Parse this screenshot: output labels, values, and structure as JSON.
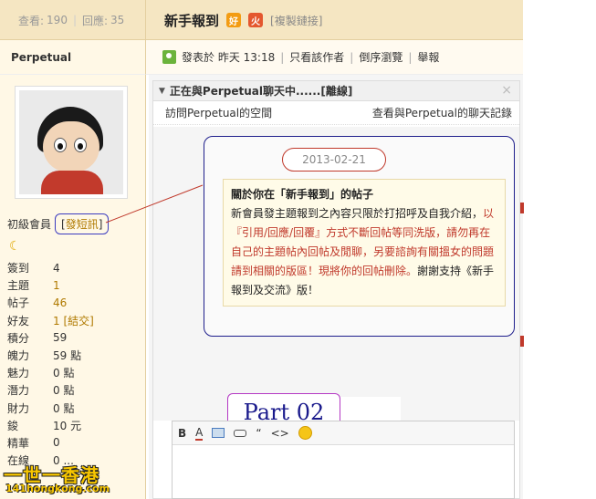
{
  "header": {
    "views_label": "查看:",
    "views": "190",
    "replies_label": "回應:",
    "replies": "35",
    "post_title": "新手報到",
    "badge_hao": "好",
    "badge_huo": "火",
    "copy_link": "[複製鏈接]"
  },
  "user": {
    "name": "Perpetual",
    "rank": "初級會員",
    "pm_label": "發短訊",
    "stats": [
      {
        "k": "簽到",
        "v": "4"
      },
      {
        "k": "主題",
        "v": "1"
      },
      {
        "k": "帖子",
        "v": "46"
      },
      {
        "k": "好友",
        "v": "1 [結交]"
      },
      {
        "k": "積分",
        "v": "59"
      },
      {
        "k": "魄力",
        "v": "59 點"
      },
      {
        "k": "魅力",
        "v": "0 點"
      },
      {
        "k": "潛力",
        "v": "0 點"
      },
      {
        "k": "財力",
        "v": "0 點"
      },
      {
        "k": "鋑",
        "v": "10 元"
      },
      {
        "k": "精華",
        "v": "0"
      },
      {
        "k": "在線",
        "v": "0 ..."
      }
    ]
  },
  "postmeta": {
    "posted": "發表於 昨天 13:18",
    "only_author": "只看該作者",
    "reverse": "倒序瀏覽",
    "report": "舉報"
  },
  "chat": {
    "title": "正在與Perpetual聊天中......[離線]",
    "close": "×",
    "visit_space": "訪問Perpetual的空間",
    "view_history": "查看與Perpetual的聊天記錄",
    "date": "2013-02-21",
    "msg_head": "關於你在「新手報到」的帖子",
    "msg_plain1": "新會員發主題報到之內容只限於打招呼及自我介紹，",
    "msg_red": "以『引用/回應/回覆』方式不斷回帖等同洗版，請勿再在自己的主題帖內回帖及閒聊，另要諮詢有關搵女的問題請到相關的版區！現將你的回帖刪除。",
    "msg_plain2": "謝謝支持《新手報到及交流》版！"
  },
  "annotation": {
    "part_label": "Part 02"
  },
  "editor": {
    "bold": "B",
    "color": "A",
    "quote": "“",
    "code": "<>"
  },
  "logo": {
    "line1": "一世一香港",
    "line2": "141hongkong.com"
  }
}
